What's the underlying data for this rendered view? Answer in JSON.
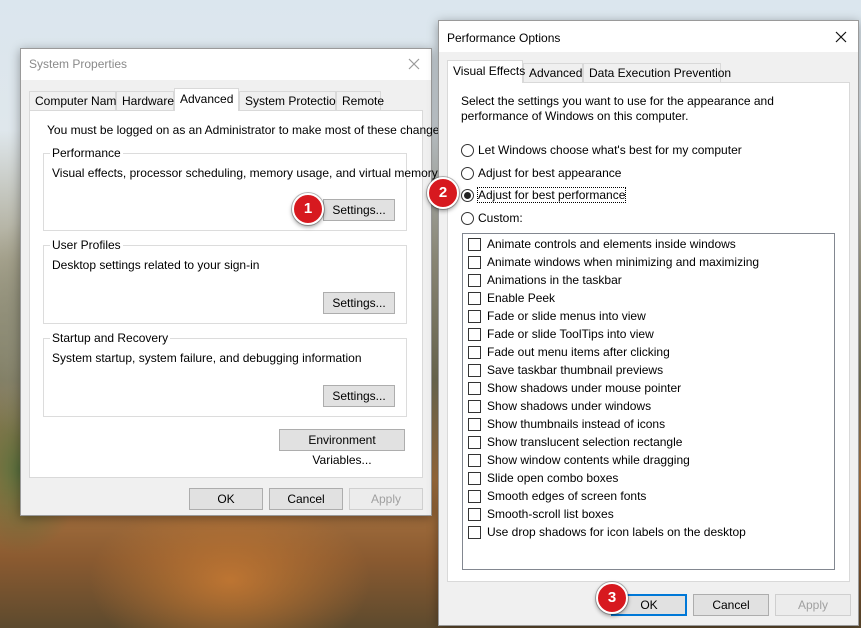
{
  "system_properties": {
    "title": "System Properties",
    "tabs": [
      {
        "label": "Computer Name"
      },
      {
        "label": "Hardware"
      },
      {
        "label": "Advanced"
      },
      {
        "label": "System Protection"
      },
      {
        "label": "Remote"
      }
    ],
    "admin_note": "You must be logged on as an Administrator to make most of these changes.",
    "performance": {
      "legend": "Performance",
      "description": "Visual effects, processor scheduling, memory usage, and virtual memory",
      "button": "Settings..."
    },
    "user_profiles": {
      "legend": "User Profiles",
      "description": "Desktop settings related to your sign-in",
      "button": "Settings..."
    },
    "startup_recovery": {
      "legend": "Startup and Recovery",
      "description": "System startup, system failure, and debugging information",
      "button": "Settings..."
    },
    "env_button": "Environment Variables...",
    "ok": "OK",
    "cancel": "Cancel",
    "apply": "Apply"
  },
  "performance_options": {
    "title": "Performance Options",
    "tabs": [
      {
        "label": "Visual Effects"
      },
      {
        "label": "Advanced"
      },
      {
        "label": "Data Execution Prevention"
      }
    ],
    "intro_line1": "Select the settings you want to use for the appearance and",
    "intro_line2": "performance of Windows on this computer.",
    "radios": [
      {
        "label": "Let Windows choose what's best for my computer",
        "checked": false
      },
      {
        "label": "Adjust for best appearance",
        "checked": false
      },
      {
        "label": "Adjust for best performance",
        "checked": true
      },
      {
        "label": "Custom:",
        "checked": false
      }
    ],
    "effects": [
      "Animate controls and elements inside windows",
      "Animate windows when minimizing and maximizing",
      "Animations in the taskbar",
      "Enable Peek",
      "Fade or slide menus into view",
      "Fade or slide ToolTips into view",
      "Fade out menu items after clicking",
      "Save taskbar thumbnail previews",
      "Show shadows under mouse pointer",
      "Show shadows under windows",
      "Show thumbnails instead of icons",
      "Show translucent selection rectangle",
      "Show window contents while dragging",
      "Slide open combo boxes",
      "Smooth edges of screen fonts",
      "Smooth-scroll list boxes",
      "Use drop shadows for icon labels on the desktop"
    ],
    "ok": "OK",
    "cancel": "Cancel",
    "apply": "Apply"
  },
  "badges": [
    "1",
    "2",
    "3"
  ],
  "colors": {
    "badge": "#d7191f",
    "focus_blue": "#0078d7"
  },
  "icons": {
    "close": "close-icon"
  }
}
